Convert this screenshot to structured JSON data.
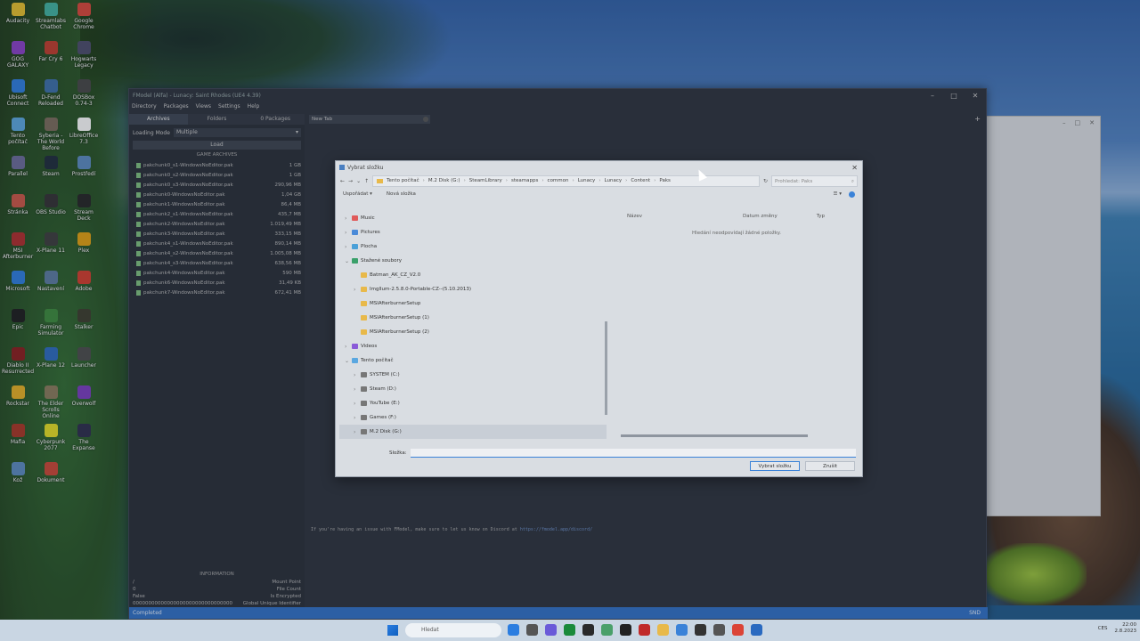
{
  "desktop": {
    "icons": [
      {
        "label": "Audacity",
        "color": "#e8c02a"
      },
      {
        "label": "Streamlabs Chatbot",
        "color": "#3fb3a0"
      },
      {
        "label": "Google Chrome",
        "color": "#db4437"
      },
      {
        "label": "GOG GALAXY",
        "color": "#8a3ec8"
      },
      {
        "label": "Far Cry 6",
        "color": "#c23a2a"
      },
      {
        "label": "Hogwarts Legacy",
        "color": "#4a4a6a"
      },
      {
        "label": "Ubisoft Connect",
        "color": "#2b7de0"
      },
      {
        "label": "D-Fend Reloaded",
        "color": "#3a6ea8"
      },
      {
        "label": "DOSBox 0.74-3",
        "color": "#444"
      },
      {
        "label": "Tento počítač",
        "color": "#5aa7e0"
      },
      {
        "label": "Syberia - The World Before",
        "color": "#7a6a5a"
      },
      {
        "label": "LibreOffice 7.3",
        "color": "#ffffff"
      },
      {
        "label": "Parallel",
        "color": "#6a6a9a"
      },
      {
        "label": "Steam",
        "color": "#1b2838"
      },
      {
        "label": "Prostředí",
        "color": "#5a8ac0"
      },
      {
        "label": "Stránka",
        "color": "#cc5544"
      },
      {
        "label": "OBS Studio",
        "color": "#302e31"
      },
      {
        "label": "Stream Deck",
        "color": "#222"
      },
      {
        "label": "MSI Afterburner",
        "color": "#b02a2a"
      },
      {
        "label": "X-Plane 11",
        "color": "#3a3a3a"
      },
      {
        "label": "Plex",
        "color": "#e5a00d"
      },
      {
        "label": "Microsoft",
        "color": "#2b7de0"
      },
      {
        "label": "Nastavení",
        "color": "#5a7aa0"
      },
      {
        "label": "Adobe",
        "color": "#d43a2a"
      },
      {
        "label": "Epic",
        "color": "#1a1a1a"
      },
      {
        "label": "Farming Simulator",
        "color": "#3a8a3a"
      },
      {
        "label": "Stalker",
        "color": "#3a3a2a"
      },
      {
        "label": "Diablo II Resurrected",
        "color": "#8a1a1a"
      },
      {
        "label": "X-Plane 12",
        "color": "#2a6ac0"
      },
      {
        "label": "Launcher",
        "color": "#4a4a4a"
      },
      {
        "label": "Rockstar",
        "color": "#e8b020"
      },
      {
        "label": "The Elder Scrolls Online",
        "color": "#8a7a5a"
      },
      {
        "label": "Overwolf",
        "color": "#7a3ac0"
      },
      {
        "label": "Mafia",
        "color": "#aa3322"
      },
      {
        "label": "Cyberpunk 2077",
        "color": "#e8e020"
      },
      {
        "label": "The Expanse",
        "color": "#2a2a4a"
      },
      {
        "label": "Kož",
        "color": "#5a8ac0"
      },
      {
        "label": "Dokument",
        "color": "#cc4433"
      }
    ]
  },
  "fmodel": {
    "title": "FModel (Alfa) - Lunacy: Saint Rhodes (UE4 4.39)",
    "menu": [
      "Directory",
      "Packages",
      "Views",
      "Settings",
      "Help"
    ],
    "tabs": {
      "archives": "Archives",
      "folders": "Folders",
      "packages": "0 Packages"
    },
    "loading_mode_label": "Loading Mode",
    "loading_mode_value": "Multiple",
    "load_button": "Load",
    "archives_header": "GAME ARCHIVES",
    "archives": [
      {
        "name": "pakchunk0_s1-WindowsNoEditor.pak",
        "size": "1 GB"
      },
      {
        "name": "pakchunk0_s2-WindowsNoEditor.pak",
        "size": "1 GB"
      },
      {
        "name": "pakchunk0_s3-WindowsNoEditor.pak",
        "size": "290,96 MB"
      },
      {
        "name": "pakchunk0-WindowsNoEditor.pak",
        "size": "1,04 GB"
      },
      {
        "name": "pakchunk1-WindowsNoEditor.pak",
        "size": "86,4 MB"
      },
      {
        "name": "pakchunk2_s1-WindowsNoEditor.pak",
        "size": "435,7 MB"
      },
      {
        "name": "pakchunk2-WindowsNoEditor.pak",
        "size": "1.019,49 MB"
      },
      {
        "name": "pakchunk3-WindowsNoEditor.pak",
        "size": "333,15 MB"
      },
      {
        "name": "pakchunk4_s1-WindowsNoEditor.pak",
        "size": "890,14 MB"
      },
      {
        "name": "pakchunk4_s2-WindowsNoEditor.pak",
        "size": "1.005,08 MB"
      },
      {
        "name": "pakchunk4_s3-WindowsNoEditor.pak",
        "size": "638,56 MB"
      },
      {
        "name": "pakchunk4-WindowsNoEditor.pak",
        "size": "590 MB"
      },
      {
        "name": "pakchunk6-WindowsNoEditor.pak",
        "size": "31,49 KB"
      },
      {
        "name": "pakchunk7-WindowsNoEditor.pak",
        "size": "672,41 MB"
      }
    ],
    "info_header": "INFORMATION",
    "info": [
      {
        "value": "/",
        "label": "Mount Point"
      },
      {
        "value": "0",
        "label": "File Count"
      },
      {
        "value": "False",
        "label": "Is Encrypted"
      },
      {
        "value": "00000000000000000000000000000000",
        "label": "Global Unique Identifier"
      }
    ],
    "tab_label": "New Tab",
    "log_text": "If you're having an issue with FModel, make sure to let us know on Discord at ",
    "log_link": "https://fmodel.app/discord/",
    "status": "Completed",
    "status_right": "SND"
  },
  "dialog": {
    "title": "Vybrat složku",
    "path": [
      "Tento počítač",
      "M.2 Disk (G:)",
      "SteamLibrary",
      "steamapps",
      "common",
      "Lunacy",
      "Lunacy",
      "Content",
      "Paks"
    ],
    "search_placeholder": "Prohledat: Paks",
    "organize": "Uspořádat ▾",
    "new_folder": "Nová složka",
    "tree": [
      {
        "label": "Music",
        "color": "#e05a5a",
        "indent": 0,
        "caret": ">"
      },
      {
        "label": "Pictures",
        "color": "#4a8ad8",
        "indent": 0,
        "caret": ">"
      },
      {
        "label": "Plocha",
        "color": "#4aa0d8",
        "indent": 0,
        "caret": ">"
      },
      {
        "label": "Stažené soubory",
        "color": "#3aa06a",
        "indent": 0,
        "caret": "v"
      },
      {
        "label": "Batman_AK_CZ_V2.0",
        "color": "#e8b94a",
        "indent": 1,
        "caret": ""
      },
      {
        "label": "Imgllum-2.5.8.0-Portable-CZ--(5.10.2013)",
        "color": "#e8b94a",
        "indent": 1,
        "caret": ">"
      },
      {
        "label": "MSIAfterburnerSetup",
        "color": "#e8b94a",
        "indent": 1,
        "caret": ""
      },
      {
        "label": "MSIAfterburnerSetup (1)",
        "color": "#e8b94a",
        "indent": 1,
        "caret": ""
      },
      {
        "label": "MSIAfterburnerSetup (2)",
        "color": "#e8b94a",
        "indent": 1,
        "caret": ""
      },
      {
        "label": "Videos",
        "color": "#8a5ad8",
        "indent": 0,
        "caret": ">"
      },
      {
        "label": "Tento počítač",
        "color": "#5aa7e0",
        "indent": 0,
        "caret": "v"
      },
      {
        "label": "SYSTEM (C:)",
        "color": "#777",
        "indent": 1,
        "caret": ">"
      },
      {
        "label": "Steam (D:)",
        "color": "#777",
        "indent": 1,
        "caret": ">"
      },
      {
        "label": "YouTube (E:)",
        "color": "#777",
        "indent": 1,
        "caret": ">"
      },
      {
        "label": "Games (F:)",
        "color": "#777",
        "indent": 1,
        "caret": ">"
      },
      {
        "label": "M.2 Disk (G:)",
        "color": "#777",
        "indent": 1,
        "caret": ">"
      }
    ],
    "columns": {
      "name": "Název",
      "date": "Datum změny",
      "type": "Typ"
    },
    "empty_message": "Hledání neodpovídají žádné položky.",
    "folder_label": "Složka:",
    "select_button": "Vybrat složku",
    "cancel_button": "Zrušit"
  },
  "taskbar": {
    "search_placeholder": "Hledat",
    "lang": "CES",
    "time": "22:00",
    "date": "2.8.2023",
    "apps": [
      "#2b7de0",
      "#555",
      "#6a5ad8",
      "#1a8a3a",
      "#2a2a2a",
      "#4aa06a",
      "#222",
      "#c02a2a",
      "#e8b94a",
      "#3a82d8",
      "#333",
      "#555",
      "#db4437",
      "#2a6ac0"
    ]
  }
}
